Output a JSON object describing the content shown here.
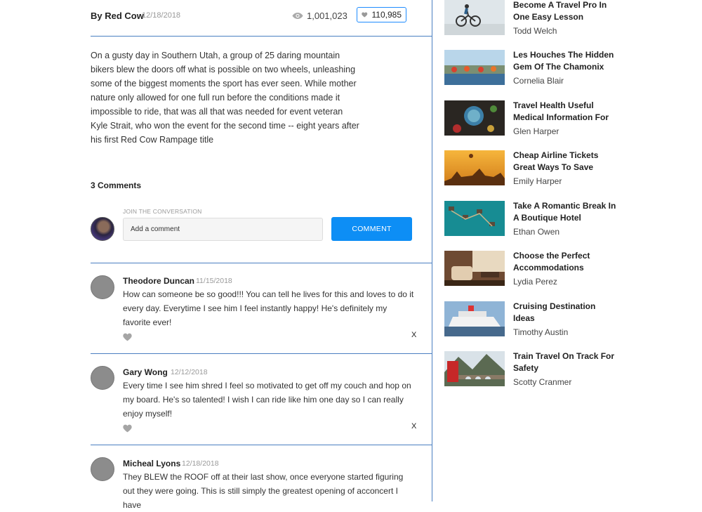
{
  "post": {
    "author": "By Red Cow",
    "date": "12/18/2018",
    "views": "1,001,023",
    "likes": "110,985",
    "body": "On a gusty day in Southern Utah, a group of 25 daring mountain bikers blew the doors off what is possible on two wheels, unleashing some of the biggest moments the sport has ever seen. While mother nature only allowed for one full run before the conditions made it impossible to ride, that was all that was needed for event veteran Kyle Strait, who won the event for the second time -- eight years after his first Red Cow Rampage title"
  },
  "comments_section": {
    "title": "3 Comments",
    "join_label": "JOIN THE CONVERSATION",
    "input_placeholder": "Add a comment",
    "submit_label": "COMMENT"
  },
  "comments": [
    {
      "name": "Theodore Duncan",
      "date": "11/15/2018",
      "text": "How can someone be so good!!! You can tell he lives for this and loves to do it every day. Everytime I see him I feel instantly happy! He's definitely my favorite ever!",
      "close": "X"
    },
    {
      "name": "Gary Wong",
      "date": "12/12/2018",
      "text": "Every time I see him shred I feel so motivated to get off my couch and hop on my board. He's so talented! I wish I can ride like him one day so I can really enjoy myself!",
      "close": "X"
    },
    {
      "name": "Micheal Lyons",
      "date": "12/18/2018",
      "text": "They BLEW the ROOF off at their last show, once everyone started figuring out they were going. This is still simply the greatest opening of acconcert I have",
      "close": ""
    }
  ],
  "sidebar": [
    {
      "title": "Become A Travel Pro In One Easy Lesson",
      "author": "Todd Welch"
    },
    {
      "title": "Les Houches The Hidden Gem Of The Chamonix",
      "author": "Cornelia Blair"
    },
    {
      "title": "Travel Health Useful Medical Information For",
      "author": "Glen Harper"
    },
    {
      "title": "Cheap Airline Tickets Great Ways To Save",
      "author": "Emily Harper"
    },
    {
      "title": "Take A Romantic Break In A Boutique Hotel",
      "author": "Ethan Owen"
    },
    {
      "title": "Choose the Perfect Accommodations",
      "author": "Lydia Perez"
    },
    {
      "title": "Cruising Destination Ideas",
      "author": "Timothy Austin"
    },
    {
      "title": "Train Travel On Track For Safety",
      "author": "Scotty Cranmer"
    }
  ],
  "colors": {
    "accent": "#0d8ef5",
    "divider": "#4a7fc1",
    "muted": "#999999"
  }
}
